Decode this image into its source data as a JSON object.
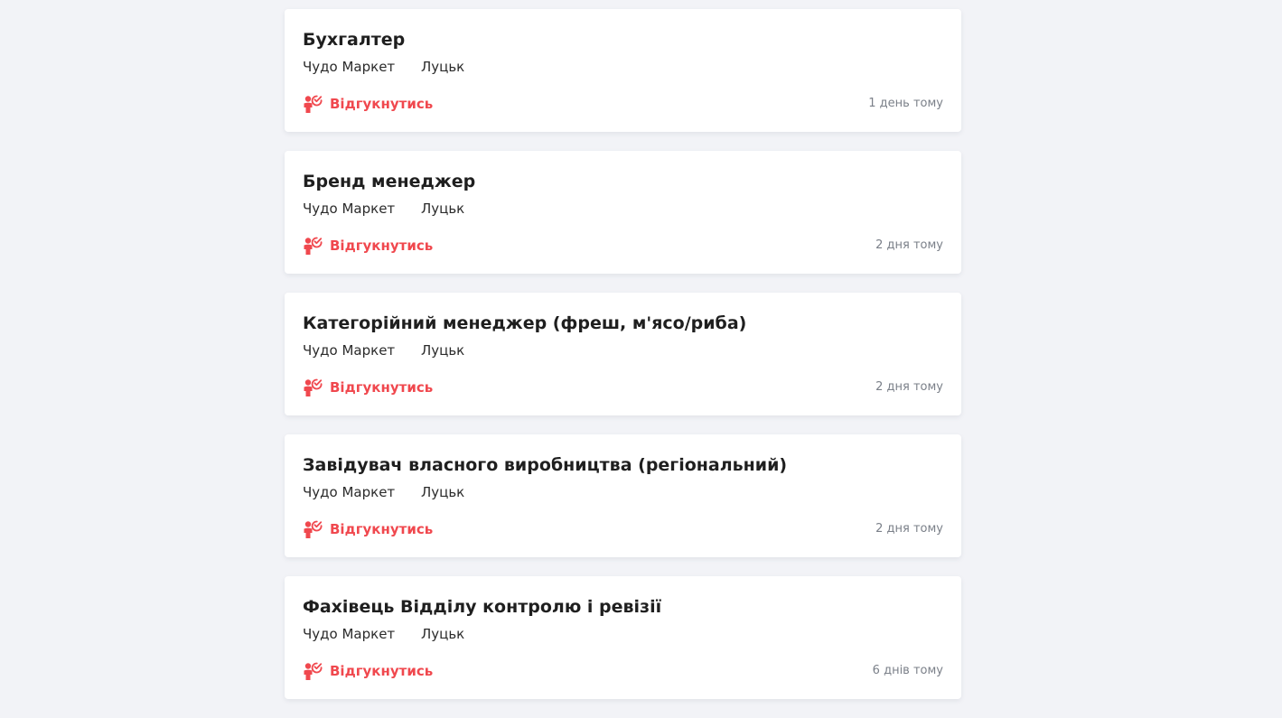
{
  "colors": {
    "background": "#f2f3f7",
    "card": "#ffffff",
    "accent": "#f0484e",
    "muted": "#7b8089"
  },
  "jobs": [
    {
      "title": "Бухгалтер",
      "company": "Чудо Маркет",
      "city": "Луцьк",
      "apply_label": "Відгукнутись",
      "apply_icon": "person-check-icon",
      "posted": "1 день тому"
    },
    {
      "title": "Бренд менеджер",
      "company": "Чудо Маркет",
      "city": "Луцьк",
      "apply_label": "Відгукнутись",
      "apply_icon": "person-check-icon",
      "posted": "2 дня тому"
    },
    {
      "title": "Категорійний менеджер (фреш, м'ясо/риба)",
      "company": "Чудо Маркет",
      "city": "Луцьк",
      "apply_label": "Відгукнутись",
      "apply_icon": "person-check-icon",
      "posted": "2 дня тому"
    },
    {
      "title": "Завідувач власного виробництва (регіональний)",
      "company": "Чудо Маркет",
      "city": "Луцьк",
      "apply_label": "Відгукнутись",
      "apply_icon": "person-check-icon",
      "posted": "2 дня тому"
    },
    {
      "title": "Фахівець Відділу контролю і ревізії",
      "company": "Чудо Маркет",
      "city": "Луцьк",
      "apply_label": "Відгукнутись",
      "apply_icon": "person-check-icon",
      "posted": "6 днів тому"
    }
  ]
}
